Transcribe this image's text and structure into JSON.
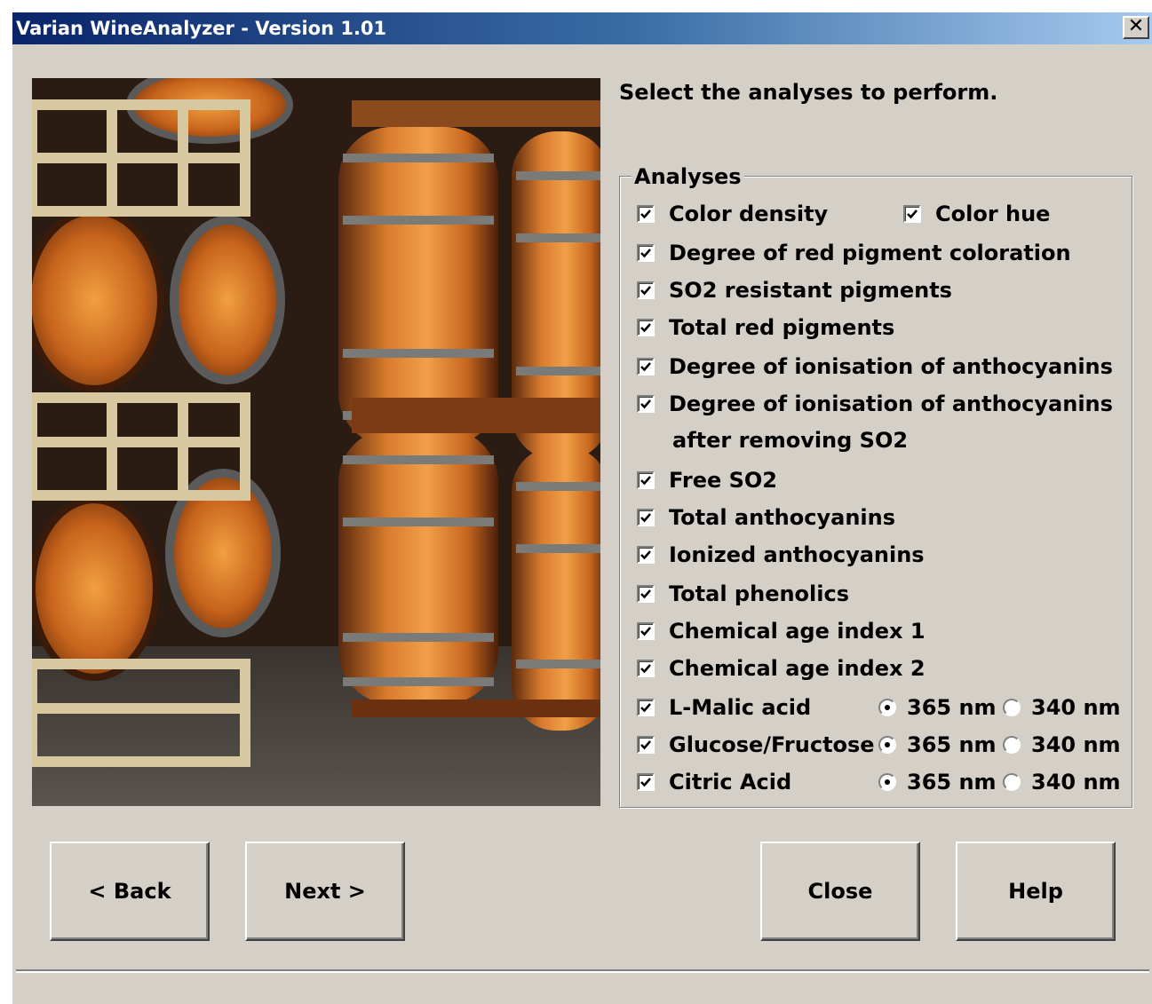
{
  "window": {
    "title": "Varian WineAnalyzer - Version 1.01",
    "close_label": "✕"
  },
  "image": {
    "description_icon": "wine-barrels-photo"
  },
  "instruction": "Select the analyses to perform.",
  "analyses": {
    "legend": "Analyses",
    "color_density": {
      "label": "Color density",
      "checked": true
    },
    "color_hue": {
      "label": "Color hue",
      "checked": true
    },
    "items": [
      {
        "label": "Degree of red pigment coloration",
        "checked": true
      },
      {
        "label": "SO2 resistant pigments",
        "checked": true
      },
      {
        "label": "Total red pigments",
        "checked": true
      },
      {
        "label": "Degree of ionisation of anthocyanins",
        "checked": true
      },
      {
        "label": "Degree of ionisation of anthocyanins",
        "checked": true
      },
      {
        "label": "Free SO2",
        "checked": true
      },
      {
        "label": "Total anthocyanins",
        "checked": true
      },
      {
        "label": "Ionized anthocyanins",
        "checked": true
      },
      {
        "label": "Total phenolics",
        "checked": true
      },
      {
        "label": "Chemical age index 1",
        "checked": true
      },
      {
        "label": "Chemical age index 2",
        "checked": true
      }
    ],
    "continuation": "after removing SO2",
    "wavelength_items": [
      {
        "label": "L-Malic acid",
        "checked": true,
        "option_a": "365 nm",
        "option_b": "340 nm",
        "selected": "365 nm"
      },
      {
        "label": "Glucose/Fructose",
        "checked": true,
        "option_a": "365 nm",
        "option_b": "340 nm",
        "selected": "365 nm"
      },
      {
        "label": "Citric Acid",
        "checked": true,
        "option_a": "365 nm",
        "option_b": "340 nm",
        "selected": "365 nm"
      }
    ]
  },
  "buttons": {
    "back": "< Back",
    "next": "Next >",
    "close": "Close",
    "help": "Help"
  }
}
